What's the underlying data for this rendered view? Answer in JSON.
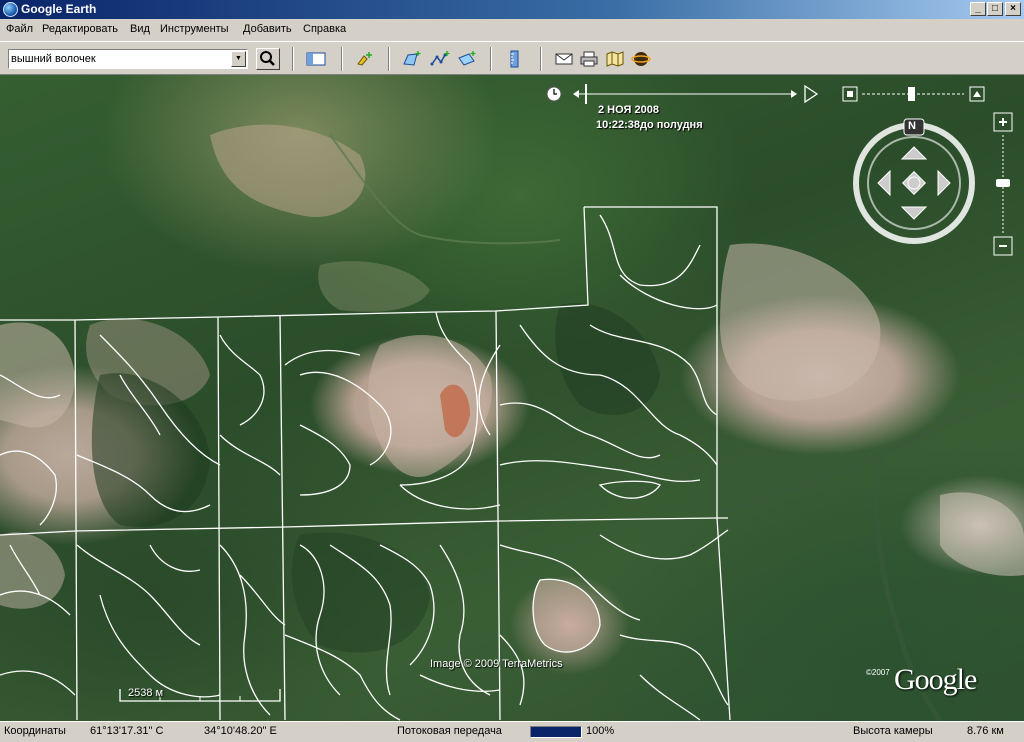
{
  "window": {
    "title": "Google Earth"
  },
  "menu": [
    {
      "label": "Файл"
    },
    {
      "label": "Редактировать"
    },
    {
      "label": "Вид"
    },
    {
      "label": "Инструменты"
    },
    {
      "label": "Добавить"
    },
    {
      "label": "Справка"
    }
  ],
  "search": {
    "value": "вышний волочек"
  },
  "time": {
    "date": "2 НОЯ 2008",
    "time": "10:22:38до полудня"
  },
  "navigation": {
    "north_label": "N"
  },
  "map": {
    "copyright": "Image © 2009 TerraMetrics",
    "scale_label": "2538 м",
    "logo_year": "©2007",
    "logo_text": "Google"
  },
  "status": {
    "coords_label": "Координаты",
    "lat": "61°13'17.31\" С",
    "lon": "34°10'48.20\" E",
    "streaming_label": "Потоковая передача",
    "streaming_percent_text": "100%",
    "streaming_fraction": 1.0,
    "camera_label": "Высота камеры",
    "camera_value": "8.76 км"
  },
  "colors": {
    "titlebar_start": "#0a246a",
    "titlebar_end": "#a6caf0",
    "overlay_lines": "#ffffff"
  },
  "icons": [
    "app-globe-icon",
    "search-icon",
    "sidebar-toggle-icon",
    "placemark-add-icon",
    "polygon-add-icon",
    "path-add-icon",
    "image-overlay-icon",
    "ruler-icon",
    "email-icon",
    "print-icon",
    "maps-icon",
    "sky-icon"
  ]
}
